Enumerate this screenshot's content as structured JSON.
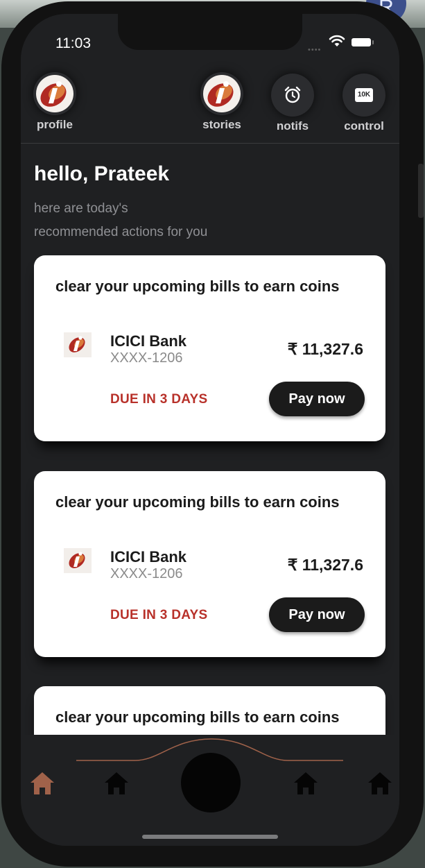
{
  "status": {
    "time": "11:03"
  },
  "nav": {
    "profile_label": "profile",
    "stories_label": "stories",
    "notifs_label": "notifs",
    "control_label": "control",
    "control_badge": "10K"
  },
  "greeting": {
    "title": "hello, Prateek",
    "line1": "here are today's",
    "line2": "recommended actions for you"
  },
  "cards": [
    {
      "title": "clear your upcoming bills to earn coins",
      "bank": "ICICI Bank",
      "account": "XXXX-1206",
      "amount": "₹ 11,327.6",
      "due": "DUE IN 3 DAYS",
      "button": "Pay now"
    },
    {
      "title": "clear your upcoming bills to earn coins",
      "bank": "ICICI Bank",
      "account": "XXXX-1206",
      "amount": "₹ 11,327.6",
      "due": "DUE IN 3 DAYS",
      "button": "Pay now"
    },
    {
      "title": "clear your upcoming bills to earn coins"
    }
  ],
  "bottom_tabs": [
    "home-icon",
    "home-icon",
    "home-icon",
    "home-icon"
  ],
  "colors": {
    "accent": "#b8312a",
    "active_tab": "#a0624a",
    "background": "#1f2022",
    "card": "#ffffff"
  }
}
